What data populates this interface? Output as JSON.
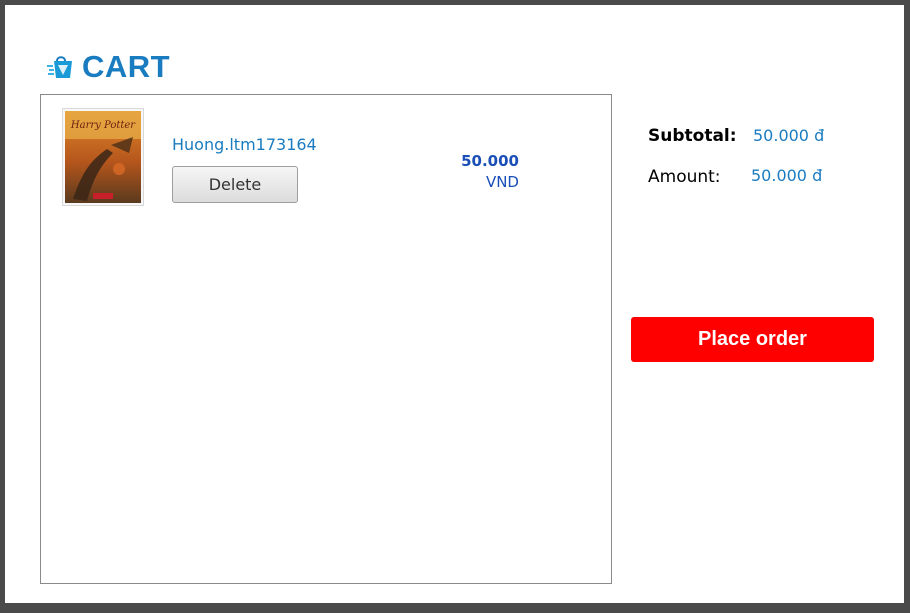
{
  "header": {
    "title": "CART",
    "logo_icon": "shopping-bag-icon"
  },
  "cart": {
    "items": [
      {
        "name": "Huong.ltm173164",
        "delete_label": "Delete",
        "price_amount": "50.000",
        "price_currency": "VND",
        "cover_title": "Harry Potter",
        "cover_icon": "book-cover-image"
      }
    ]
  },
  "summary": {
    "subtotal_label": "Subtotal:",
    "subtotal_value": "50.000 đ",
    "amount_label": "Amount:",
    "amount_value": "50.000 đ"
  },
  "actions": {
    "place_order_label": "Place order"
  },
  "colors": {
    "accent_blue": "#1a7cc0",
    "price_blue": "#1a4fb8",
    "place_order_red": "#ff0000"
  }
}
